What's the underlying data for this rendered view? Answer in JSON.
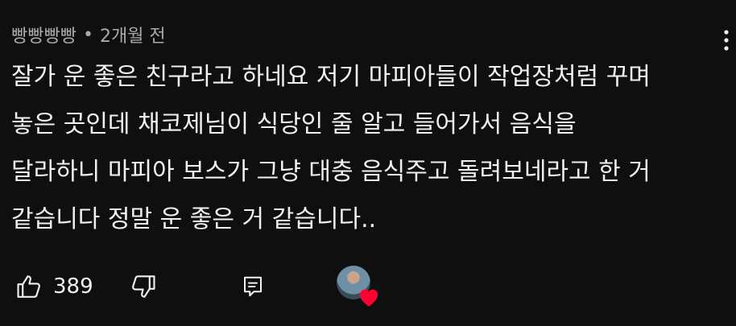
{
  "comment": {
    "author": "빵빵빵빵",
    "separator": "•",
    "time": "2개월 전",
    "text_lines": [
      "잘가 운 좋은 친구라고 하네요 저기 마피아들이 작업장처럼 꾸며",
      "놓은 곳인데 채코제님이 식당인 줄 알고 들어가서 음식을",
      "달라하니 마피아 보스가 그냥 대충 음식주고 돌려보네라고 한 거",
      "같습니다 정말 운 좋은 거 같습니다.."
    ],
    "like_count": "389"
  },
  "icons": {
    "more": "more-vertical-icon",
    "like": "thumbs-up-icon",
    "dislike": "thumbs-down-icon",
    "reply": "reply-comment-icon",
    "heart": "heart-icon"
  },
  "colors": {
    "background": "#0f0f0f",
    "text": "#f1f1f1",
    "meta_text": "#aaaaaa",
    "heart": "#ff0033"
  }
}
